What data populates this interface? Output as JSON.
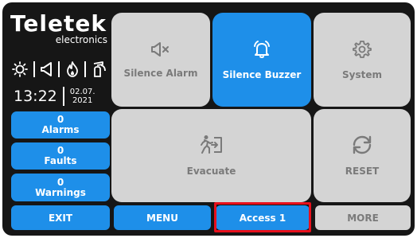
{
  "brand": {
    "logo": "Teletek",
    "sub": "electronics"
  },
  "status_icons": [
    "sun-icon",
    "speaker-icon",
    "flame-icon",
    "fire-extinguisher-icon"
  ],
  "clock": {
    "time": "13:22",
    "date_line1": "02.07.",
    "date_line2": "2021"
  },
  "counters": [
    {
      "count": "0",
      "label": "Alarms"
    },
    {
      "count": "0",
      "label": "Faults"
    },
    {
      "count": "0",
      "label": "Warnings"
    }
  ],
  "tiles": {
    "silence_alarm": "Silence Alarm",
    "silence_buzzer": "Silence Buzzer",
    "system": "System",
    "evacuate": "Evacuate",
    "reset": "RESET"
  },
  "bottom": {
    "exit": "EXIT",
    "menu": "MENU",
    "access": "Access 1",
    "more": "MORE"
  },
  "colors": {
    "accent": "#1e8fe9",
    "tile_grey": "#d4d4d4",
    "highlight": "#e8101c",
    "background": "#161616"
  }
}
